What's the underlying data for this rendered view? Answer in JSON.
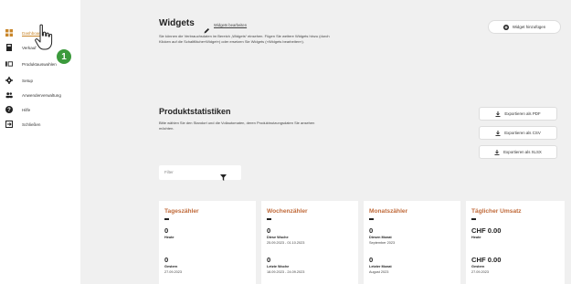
{
  "sidebar": {
    "items": [
      {
        "label": "Dashboard",
        "icon": "dashboard-icon"
      },
      {
        "label": "Verkauf",
        "icon": "sales-icon"
      },
      {
        "label": "Produktauswahlen",
        "icon": "product-selection-icon"
      },
      {
        "label": "Setup",
        "icon": "gear-icon"
      },
      {
        "label": "Anwenderverwaltung",
        "icon": "users-icon"
      },
      {
        "label": "Hilfe",
        "icon": "help-icon"
      },
      {
        "label": "Schließen",
        "icon": "logout-icon"
      }
    ]
  },
  "widgets": {
    "title": "Widgets",
    "edit_link": "Widgets bearbeiten",
    "description": "Sie können die Verbrauchsdaten im Bereich „Widgets“ einsehen. Fügen Sie weitere Widgets hinzu (durch Klicken auf die Schaltfläche»Widget«) oder ersetzen Sie Widgets (»Widgets bearbeiten«).",
    "add_button": "Widget hinzufügen"
  },
  "stats": {
    "title": "Produktstatistiken",
    "description": "Bitte wählen Sie den Standort und die Vollautomaten, deren Produktnutzungsdaten Sie ansehen möchten.",
    "export_pdf": "Exportieren als PDF",
    "export_csv": "Exportieren als CSV",
    "export_xlsx": "Exportieren als XLSX",
    "filter_label": "Filter"
  },
  "cards": [
    {
      "title": "Tageszähler",
      "v1": "0",
      "l1": "Heute",
      "s1": "",
      "v2": "0",
      "l2": "Gestern",
      "s2": "27.09.2023"
    },
    {
      "title": "Wochenzähler",
      "v1": "0",
      "l1": "Diese Woche",
      "s1": "25.09.2023 - 01.10.2023",
      "v2": "0",
      "l2": "Letzte Woche",
      "s2": "18.09.2023 - 24.09.2023"
    },
    {
      "title": "Monatszähler",
      "v1": "0",
      "l1": "Diesen Monat",
      "s1": "September 2023",
      "v2": "0",
      "l2": "Letzter Monat",
      "s2": "August 2023"
    },
    {
      "title": "Täglicher Umsatz",
      "v1": "CHF 0.00",
      "l1": "Heute",
      "s1": "",
      "v2": "CHF 0.00",
      "l2": "Gestern",
      "s2": "27.09.2023"
    }
  ],
  "step_badge": "1",
  "colors": {
    "accent": "#c9862a",
    "card_title": "#c06a3a",
    "badge": "#3b9a3c",
    "background": "#f0f0f0"
  }
}
